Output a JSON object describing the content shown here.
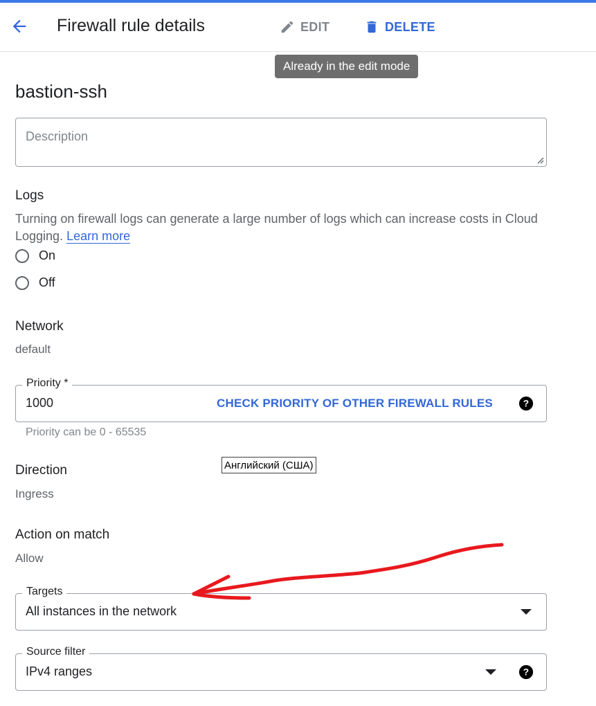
{
  "header": {
    "title": "Firewall rule details",
    "edit_label": "EDIT",
    "delete_label": "DELETE",
    "tooltip": "Already in the edit mode"
  },
  "rule": {
    "name": "bastion-ssh",
    "description_placeholder": "Description"
  },
  "logs": {
    "label": "Logs",
    "help_text": "Turning on firewall logs can generate a large number of logs which can increase costs in Cloud Logging.",
    "learn_more": "Learn more",
    "options": [
      "On",
      "Off"
    ]
  },
  "network": {
    "label": "Network",
    "value": "default"
  },
  "priority": {
    "label": "Priority *",
    "value": "1000",
    "check_link": "CHECK PRIORITY OF OTHER FIREWALL RULES",
    "hint": "Priority can be 0 - 65535"
  },
  "language_tooltip": "Английский (США)",
  "direction": {
    "label": "Direction",
    "value": "Ingress"
  },
  "action": {
    "label": "Action on match",
    "value": "Allow"
  },
  "targets": {
    "label": "Targets",
    "value": "All instances in the network"
  },
  "source_filter": {
    "label": "Source filter",
    "value": "IPv4 ranges"
  },
  "colors": {
    "accent": "#3367d6",
    "annotation": "#e8191e",
    "tooltip_bg": "#6e6e6e"
  }
}
